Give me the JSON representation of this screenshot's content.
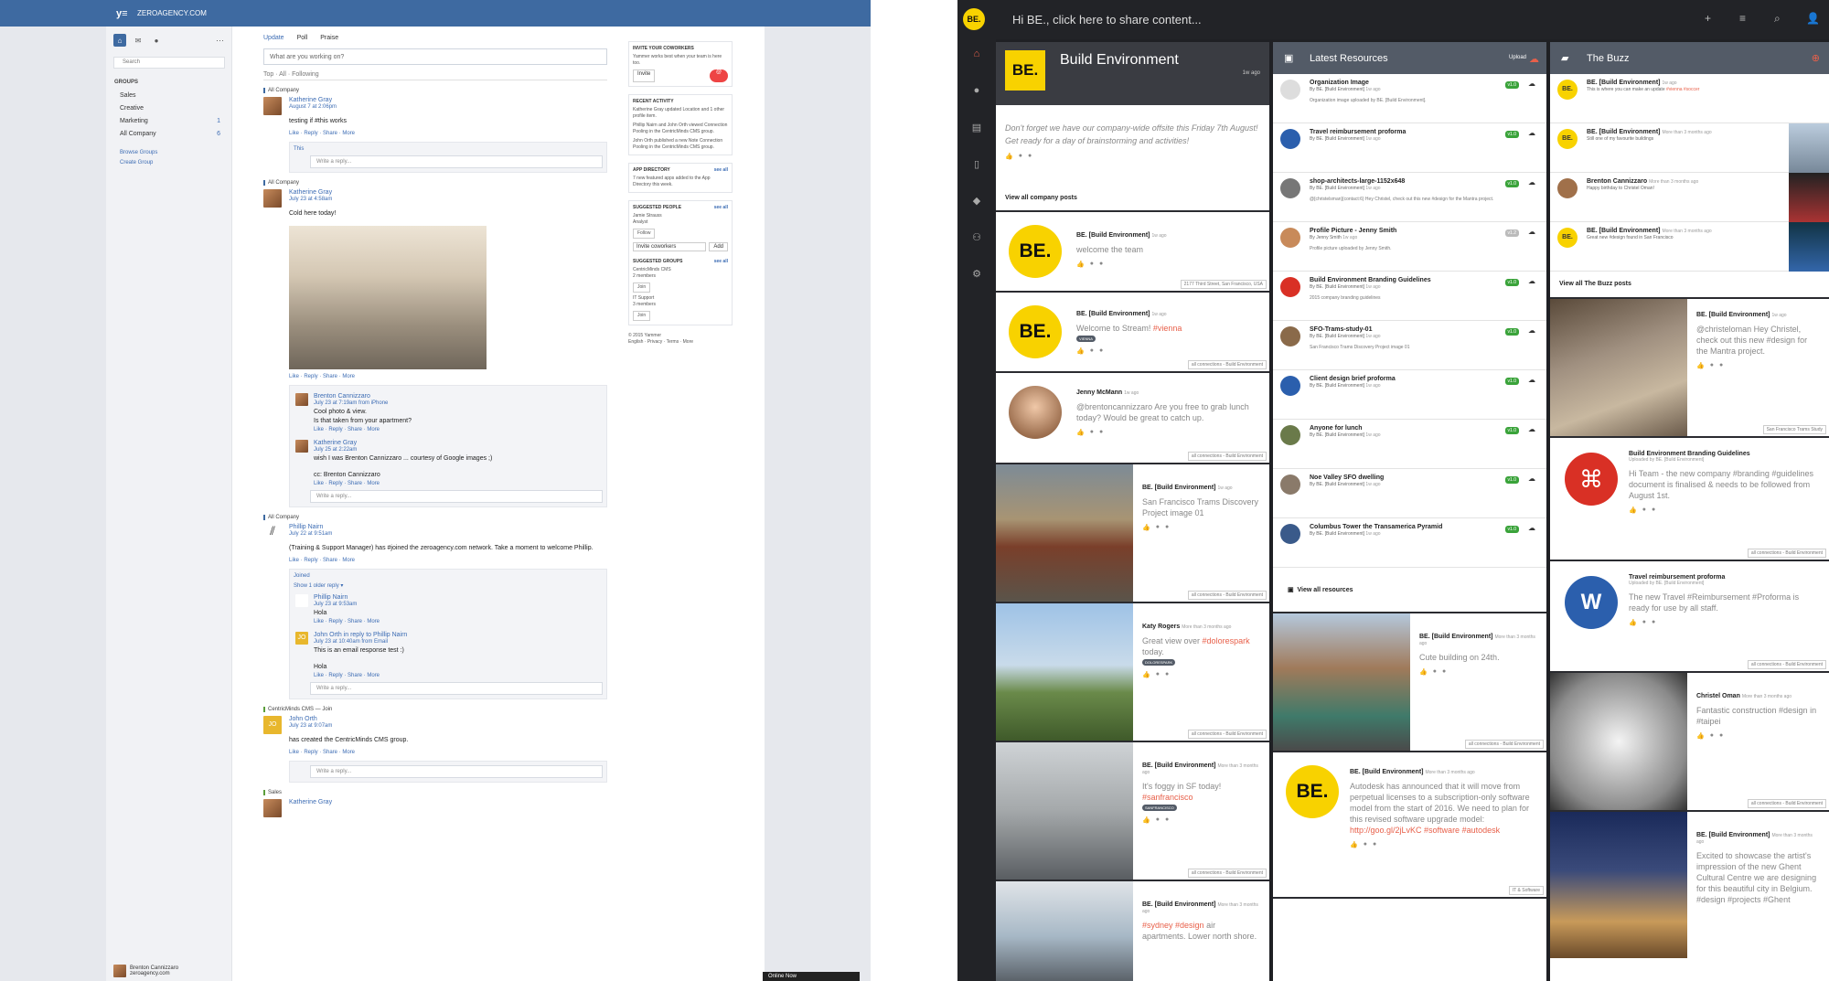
{
  "yammer": {
    "logo": "y≡",
    "network": "ZEROAGENCY.COM",
    "search_placeholder": "Search",
    "groups_heading": "GROUPS",
    "groups": [
      {
        "label": "Sales",
        "count": ""
      },
      {
        "label": "Creative",
        "count": ""
      },
      {
        "label": "Marketing",
        "count": "1"
      },
      {
        "label": "All Company",
        "count": "6"
      }
    ],
    "browse": "Browse Groups",
    "create": "Create Group",
    "user": "Brenton Cannizzaro",
    "user_sub": "zeroagency.com",
    "publisher_tabs": [
      "Update",
      "Poll",
      "Praise"
    ],
    "publisher_placeholder": "What are you working on?",
    "feed_tabs": "Top · All · Following",
    "posts": [
      {
        "group": "All Company",
        "author": "Katherine Gray",
        "time": "August 7 at 2:06pm",
        "text": "testing if #this works",
        "actions": "Like · Reply · Share · More",
        "liked": "This",
        "reply_placeholder": "Write a reply..."
      },
      {
        "group": "All Company",
        "author": "Katherine Gray",
        "time": "July 23 at 4:58am",
        "text": "Cold here today!",
        "actions": "Like · Reply · Share · More",
        "replies": [
          {
            "author": "Brenton Cannizzaro",
            "time": "July 23 at 7:19am from iPhone",
            "text": "Cool photo & view.",
            "text2": "Is that taken from your apartment?",
            "actions": "Like · Reply · Share · More"
          },
          {
            "author": "Katherine Gray",
            "time": "July 25 at 2:22am",
            "text": "wish I was Brenton Cannizzaro ... courtesy of Google images ;)",
            "text2": "cc: Brenton Cannizzaro",
            "actions": "Like · Reply · Share · More"
          }
        ],
        "reply_placeholder": "Write a reply..."
      },
      {
        "group": "All Company",
        "author": "Phillip Nairn",
        "time": "July 22 at 9:51am",
        "text": "(Training & Support Manager) has #joined the zeroagency.com network. Take a moment to welcome Phillip.",
        "actions": "Like · Reply · Share · More",
        "liked": "Joined",
        "older": "Show 1 older reply ▾",
        "replies": [
          {
            "author": "Phillip Nairn",
            "time": "July 23 at 9:53am",
            "text": "Hola",
            "text2": "",
            "actions": "Like · Reply · Share · More"
          },
          {
            "author": "John Orth in reply to Phillip Nairn",
            "time": "July 23 at 10:40am from Email",
            "text": "This is an email response test :)",
            "text2": "Hola",
            "actions": "Like · Reply · Share · More"
          }
        ],
        "reply_placeholder": "Write a reply..."
      },
      {
        "group": "CentricMinds CMS — Join",
        "author": "John Orth",
        "time": "July 23 at 9:07am",
        "text": "has created the CentricMinds CMS group.",
        "actions": "Like · Reply · Share · More",
        "reply_placeholder": "Write a reply..."
      },
      {
        "group": "Sales",
        "author": "Katherine Gray"
      }
    ],
    "invite": {
      "title": "INVITE YOUR COWORKERS",
      "text": "Yammer works best when your team is here too.",
      "button": "Invite"
    },
    "activity": {
      "title": "RECENT ACTIVITY",
      "items": [
        "Katherine Gray updated Location and 1 other profile item.",
        "Phillip Nairn and John Orth viewed Connection Pooling in the CentricMinds CMS group.",
        "John Orth published a new Note Connection Pooling in the CentricMinds CMS group."
      ]
    },
    "apps": {
      "title": "APP DIRECTORY",
      "link": "see all",
      "text": "7 new featured apps added to the App Directory this week."
    },
    "people": {
      "title": "SUGGESTED PEOPLE",
      "link": "see all",
      "name": "Jamie Strauss",
      "role": "Analyst",
      "follow": "Follow",
      "invite_placeholder": "Invite coworkers",
      "add": "Add"
    },
    "sgroups": {
      "title": "SUGGESTED GROUPS",
      "link": "see all",
      "items": [
        {
          "name": "CentricMinds CMS",
          "members": "2 members",
          "join": "Join"
        },
        {
          "name": "IT Support",
          "members": "3 members",
          "join": "Join"
        }
      ]
    },
    "footer": "© 2015 Yammer",
    "footer_links": "English · Privacy · Terms · More",
    "online": "Online Now"
  },
  "be": {
    "logo": "BE.",
    "greeting": "Hi BE., click here to share content...",
    "top_icons": [
      "+",
      "≡",
      "⌕",
      "👤"
    ],
    "columns": {
      "env": {
        "title": "Build Environment",
        "time": "1w ago",
        "announcement": "Don't forget we have our company-wide offsite this Friday 7th August! Get ready for a day of brainstorming and activities!",
        "view_all": "View all company posts"
      },
      "res": {
        "title": "Latest Resources",
        "upload": "Upload",
        "view_all": "View all resources"
      },
      "buzz": {
        "title": "The Buzz",
        "view_all": "View all The Buzz posts"
      }
    },
    "env_cards": [
      {
        "name": "BE. [Build Environment]",
        "time": "1w ago",
        "text": "welcome the team",
        "foot": "2177 Third Street, San Francisco, USA"
      },
      {
        "name": "BE. [Build Environment]",
        "time": "1w ago",
        "text": "Welcome to Stream!",
        "hash": "#vienna",
        "chip": "VIENNA",
        "foot": "all connections - Build Environment"
      },
      {
        "name": "Jenny McMann",
        "time": "1w ago",
        "text": "@brentoncannizzaro Are you free to grab lunch today? Would be great to catch up.",
        "foot": "all connections - Build Environment"
      },
      {
        "name": "BE. [Build Environment]",
        "time": "1w ago",
        "text": "San Francisco Trams Discovery Project image 01",
        "foot": "all connections - Build Environment"
      },
      {
        "name": "Katy Rogers",
        "time": "More than 3 months ago",
        "text": "Great view over",
        "hash": "#dolorespark",
        "text2": "today.",
        "chip": "DOLORESPARK",
        "foot": "all connections - Build Environment"
      },
      {
        "name": "BE. [Build Environment]",
        "time": "More than 3 months ago",
        "text": "It's foggy in SF today!",
        "hash": "#sanfrancisco",
        "chip": "SANFRANCISCO",
        "foot": "all connections - Build Environment"
      },
      {
        "name": "BE. [Build Environment]",
        "time": "More than 3 months ago",
        "text": "air apartments. Lower north shore.",
        "hash": "#sydney #design"
      }
    ],
    "resources": [
      {
        "title": "Organization Image",
        "by": "By BE. [Build Environment]",
        "time": "1w ago",
        "body": "Organization image uploaded by BE. [Build Environment].",
        "ver": "v1.0"
      },
      {
        "title": "Travel reimbursement proforma",
        "by": "By BE. [Build Environment]",
        "time": "1w ago",
        "body": "",
        "ver": "v1.0"
      },
      {
        "title": "shop-architects-large-1152x648",
        "by": "By BE. [Build Environment]",
        "time": "1w ago",
        "body": "@[christelsman](contact:6) Hey Christel, check out this new #design for the Mantra project.",
        "ver": "v1.0"
      },
      {
        "title": "Profile Picture - Jenny Smith",
        "by": "By Jenny Smith",
        "time": "1w ago",
        "body": "Profile picture uploaded by Jenny Smith.",
        "ver": "v1.2"
      },
      {
        "title": "Build Environment Branding Guidelines",
        "by": "By BE. [Build Environment]",
        "time": "1w ago",
        "body": "2015 company branding guidelines",
        "ver": "v1.0"
      },
      {
        "title": "SFO-Trams-study-01",
        "by": "By BE. [Build Environment]",
        "time": "1w ago",
        "body": "San Francisco Trams Discovery Project image 01",
        "ver": "v1.0"
      },
      {
        "title": "Client design brief proforma",
        "by": "By BE. [Build Environment]",
        "time": "1w ago",
        "body": "",
        "ver": "v1.0"
      },
      {
        "title": "Anyone for lunch",
        "by": "By BE. [Build Environment]",
        "time": "1w ago",
        "body": "",
        "ver": "v1.0"
      },
      {
        "title": "Noe Valley SFO dwelling",
        "by": "By BE. [Build Environment]",
        "time": "1w ago",
        "body": "",
        "ver": "v1.0"
      },
      {
        "title": "Columbus Tower the Transamerica Pyramid",
        "by": "By BE. [Build Environment]",
        "time": "1w ago",
        "body": "",
        "ver": "v1.0"
      }
    ],
    "mid_cards": [
      {
        "name": "BE. [Build Environment]",
        "time": "More than 3 months ago",
        "text": "Cute building on 24th.",
        "foot": "all connections - Build Environment"
      },
      {
        "name": "BE. [Build Environment]",
        "time": "More than 3 months ago",
        "text": "Autodesk has announced that it will move from perpetual licenses to a subscription-only software model from the start of 2016. We need to plan for this revised software upgrade model:",
        "hash": "http://goo.gl/2jLvKC #software #autodesk",
        "foot": "IT & Software"
      }
    ],
    "buzz": [
      {
        "name": "BE. [Build Environment]",
        "time": "1w ago",
        "text": "This is where you can make an update",
        "hash": "#vienna #soccer"
      },
      {
        "name": "BE. [Build Environment]",
        "time": "More than 3 months ago",
        "text": "Still one of my favourite buildings"
      },
      {
        "name": "Brenton Cannizzaro",
        "time": "More than 3 months ago",
        "text": "Happy birthday to Christel Oman!"
      },
      {
        "name": "BE. [Build Environment]",
        "time": "More than 3 months ago",
        "text": "Great new #design found in San Francisco"
      }
    ],
    "buzz_cards": [
      {
        "name": "BE. [Build Environment]",
        "time": "1w ago",
        "text": "@christeloman Hey Christel, check out this new #design for the Mantra project.",
        "foot": "San Francisco Trams Study"
      },
      {
        "name": "Build Environment Branding Guidelines",
        "time": "Uploaded by BE. [Build Environment]",
        "text": "Hi Team - the new company #branding #guidelines document is finalised & needs to be followed from August 1st.",
        "foot": "all connections - Build Environment"
      },
      {
        "name": "Travel reimbursement proforma",
        "time": "Uploaded by BE. [Build Environment]",
        "text": "The new Travel #Reimbursement #Proforma is ready for use by all staff.",
        "foot": "all connections - Build Environment"
      },
      {
        "name": "Christel Oman",
        "time": "More than 3 months ago",
        "text": "Fantastic construction #design in #taipei",
        "foot": "all connections - Build Environment"
      },
      {
        "name": "BE. [Build Environment]",
        "time": "More than 3 months ago",
        "text": "Excited to showcase the artist's impression of the new Ghent Cultural Centre we are designing for this beautiful city in Belgium. #design #projects #Ghent"
      }
    ]
  }
}
